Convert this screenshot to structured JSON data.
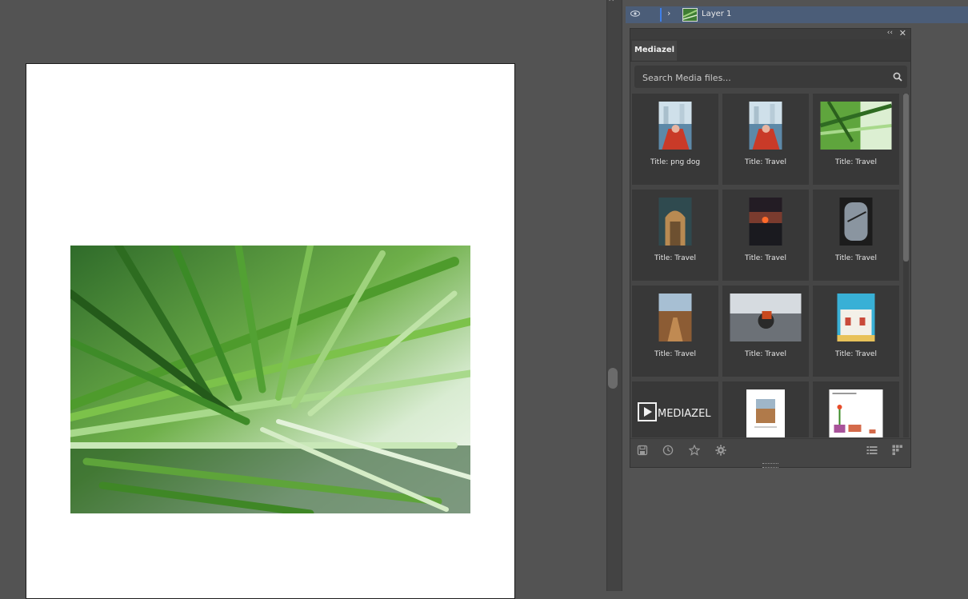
{
  "layers": {
    "layer_name": "Layer 1"
  },
  "mediazel": {
    "tab_label": "Mediazel",
    "search_placeholder": "Search Media files...",
    "collapse_glyph": "‹‹",
    "close_glyph": "✕",
    "tiles": [
      {
        "caption": "Title: png dog",
        "kind": "kayak"
      },
      {
        "caption": "Title: Travel",
        "kind": "kayak"
      },
      {
        "caption": "Title: Travel",
        "kind": "palm"
      },
      {
        "caption": "Title: Travel",
        "kind": "arch"
      },
      {
        "caption": "Title: Travel",
        "kind": "sunset"
      },
      {
        "caption": "Title: Travel",
        "kind": "window"
      },
      {
        "caption": "Title: Travel",
        "kind": "road"
      },
      {
        "caption": "Title: Travel",
        "kind": "moto"
      },
      {
        "caption": "Title: Travel",
        "kind": "house"
      },
      {
        "caption": "",
        "kind": "logo",
        "logo_text": "MEDIAZEL"
      },
      {
        "caption": "",
        "kind": "doc"
      },
      {
        "caption": "",
        "kind": "plants"
      }
    ],
    "footer_icons": [
      "save-icon",
      "history-icon",
      "star-icon",
      "gear-icon",
      "list-view-icon",
      "grid-view-icon"
    ]
  }
}
